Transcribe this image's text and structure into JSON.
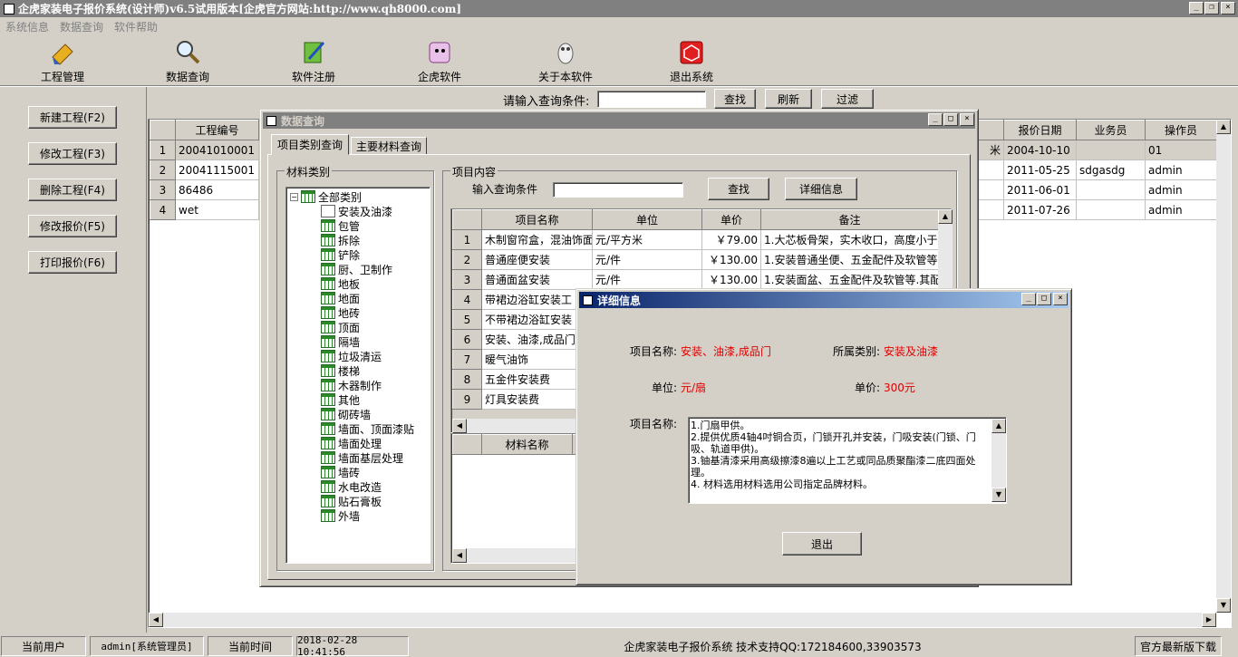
{
  "window": {
    "title": "企虎家装电子报价系统(设计师)v6.5试用版本[企虎官方网站:http://www.qh8000.com]",
    "controls": [
      "_",
      "❐",
      "×"
    ]
  },
  "menu": [
    "系统信息",
    "数据查询",
    "软件帮助"
  ],
  "toolbar": [
    {
      "label": "工程管理",
      "icon": "project-management-icon"
    },
    {
      "label": "数据查询",
      "icon": "data-query-icon"
    },
    {
      "label": "软件注册",
      "icon": "software-register-icon"
    },
    {
      "label": "企虎软件",
      "icon": "qihu-software-icon"
    },
    {
      "label": "关于本软件",
      "icon": "about-software-icon"
    },
    {
      "label": "退出系统",
      "icon": "exit-system-icon"
    }
  ],
  "sidebar": [
    "新建工程(F2)",
    "修改工程(F3)",
    "删除工程(F4)",
    "修改报价(F5)",
    "打印报价(F6)"
  ],
  "query_bar": {
    "label": "请输入查询条件:",
    "value": "",
    "buttons": [
      "查找",
      "刷新",
      "过滤"
    ]
  },
  "main_grid": {
    "left_headers": [
      "",
      "工程编号"
    ],
    "right_headers": [
      "报价日期",
      "业务员",
      "操作员"
    ],
    "rows": [
      {
        "num": "1",
        "code": "20041010001",
        "mid": "米",
        "date": "2004-10-10",
        "sales": "",
        "operator": "01"
      },
      {
        "num": "2",
        "code": "20041115001",
        "mid": "",
        "date": "2011-05-25",
        "sales": "sdgasdg",
        "operator": "admin"
      },
      {
        "num": "3",
        "code": "86486",
        "mid": "",
        "date": "2011-06-01",
        "sales": "",
        "operator": "admin"
      },
      {
        "num": "4",
        "code": "wet",
        "mid": "",
        "date": "2011-07-26",
        "sales": "",
        "operator": "admin"
      }
    ]
  },
  "data_query": {
    "title": "数据查询",
    "tabs": [
      "项目类别查询",
      "主要材料查询"
    ],
    "category_group": "材料类别",
    "tree_root": "全部类别",
    "tree_items": [
      "安装及油漆",
      "包管",
      "拆除",
      "铲除",
      "厨、卫制作",
      "地板",
      "地面",
      "地砖",
      "顶面",
      "隔墙",
      "垃圾清运",
      "楼梯",
      "木器制作",
      "其他",
      "砌砖墙",
      "墙面、顶面漆贴",
      "墙面处理",
      "墙面基层处理",
      "墙砖",
      "水电改造",
      "贴石膏板",
      "外墙"
    ],
    "content_group": "项目内容",
    "search_label": "输入查询条件",
    "search_value": "",
    "btn_search": "查找",
    "btn_detail": "详细信息",
    "item_headers": [
      "",
      "项目名称",
      "单位",
      "单价",
      "备注"
    ],
    "items": [
      {
        "num": "1",
        "name": "木制窗帘盒，混油饰面",
        "unit": "元/平方米",
        "price": "￥79.00",
        "note": "1.大芯板骨架，实木收口，高度小于2"
      },
      {
        "num": "2",
        "name": "普通座便安装",
        "unit": "元/件",
        "price": "￥130.00",
        "note": "1.安装普通坐便、五金配件及软管等"
      },
      {
        "num": "3",
        "name": "普通面盆安装",
        "unit": "元/件",
        "price": "￥130.00",
        "note": "1.安装面盆、五金配件及软管等.其配"
      },
      {
        "num": "4",
        "name": "带裙边浴缸安装工",
        "unit": "",
        "price": "",
        "note": ""
      },
      {
        "num": "5",
        "name": "不带裙边浴缸安装",
        "unit": "",
        "price": "",
        "note": ""
      },
      {
        "num": "6",
        "name": "安装、油漆,成品门",
        "unit": "",
        "price": "",
        "note": ""
      },
      {
        "num": "7",
        "name": "暖气油饰",
        "unit": "",
        "price": "",
        "note": ""
      },
      {
        "num": "8",
        "name": "五金件安装费",
        "unit": "",
        "price": "",
        "note": ""
      },
      {
        "num": "9",
        "name": "灯具安装费",
        "unit": "",
        "price": "",
        "note": ""
      }
    ],
    "material_header": "材料名称"
  },
  "detail": {
    "title": "详细信息",
    "name_label": "项目名称:",
    "name_value": "安装、油漆,成品门",
    "category_label": "所属类别:",
    "category_value": "安装及油漆",
    "unit_label": "单位:",
    "unit_value": "元/扇",
    "price_label": "单价:",
    "price_value": "300元",
    "desc_label": "项目名称:",
    "desc_lines": [
      "1.门扇甲供。",
      "2.提供优质4轴4吋铜合页，门锁开孔并安装，门吸安装(门锁、门吸、轨道甲供)。",
      "3.铀基清漆采用高级擦漆8遍以上工艺或同品质聚酯漆二底四面处理。",
      "4. 材料选用材料选用公司指定品牌材料。"
    ],
    "exit": "退出"
  },
  "statusbar": {
    "user_label": "当前用户",
    "user_value": "admin[系统管理员]",
    "time_label": "当前时间",
    "time_value": "2018-02-28 10:41:56",
    "info": "企虎家装电子报价系统   技术支持QQ:172184600,33903573",
    "download": "官方最新版下载"
  },
  "colors": {
    "accent_title": "#0a246a",
    "value_red": "#e00000"
  }
}
